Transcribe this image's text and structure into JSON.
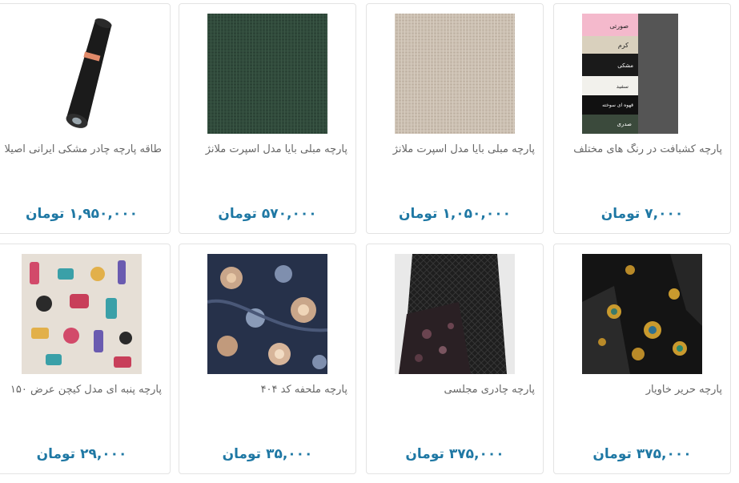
{
  "products": [
    {
      "title": "پارچه کشبافت در رنگ های مختلف",
      "price": "۷,۰۰۰",
      "currency": "تومان",
      "image": "color-swatches-fabric",
      "swatch_labels": [
        "صورتی",
        "کرم",
        "مشکی",
        "سفید",
        "قهوه ای سوخته",
        "صدری"
      ]
    },
    {
      "title": "پارچه مبلی بایا مدل اسپرت ملانژ",
      "price": "۱,۰۵۰,۰۰۰",
      "currency": "تومان",
      "image": "beige-linen-fabric"
    },
    {
      "title": "پارچه مبلی بایا مدل اسپرت ملانژ",
      "price": "۵۷۰,۰۰۰",
      "currency": "تومان",
      "image": "green-linen-fabric"
    },
    {
      "title": "طاقه پارچه چادر مشکی ایرانی اصیلا",
      "price": "۱,۹۵۰,۰۰۰",
      "currency": "تومان",
      "image": "black-fabric-roll"
    },
    {
      "title": "پارچه حریر خاویار",
      "price": "۳۷۵,۰۰۰",
      "currency": "تومان",
      "image": "black-embroidered-silk"
    },
    {
      "title": "پارچه چادری مجلسی",
      "price": "۳۷۵,۰۰۰",
      "currency": "تومان",
      "image": "black-patterned-chador-fabric"
    },
    {
      "title": "پارچه ملحفه کد ۴۰۴",
      "price": "۳۵,۰۰۰",
      "currency": "تومان",
      "image": "navy-floral-sheet-fabric"
    },
    {
      "title": "پارچه پنبه ای مدل کیچن عرض ۱۵۰",
      "price": "۲۹,۰۰۰",
      "currency": "تومان",
      "image": "kitchen-print-cotton-fabric"
    }
  ]
}
